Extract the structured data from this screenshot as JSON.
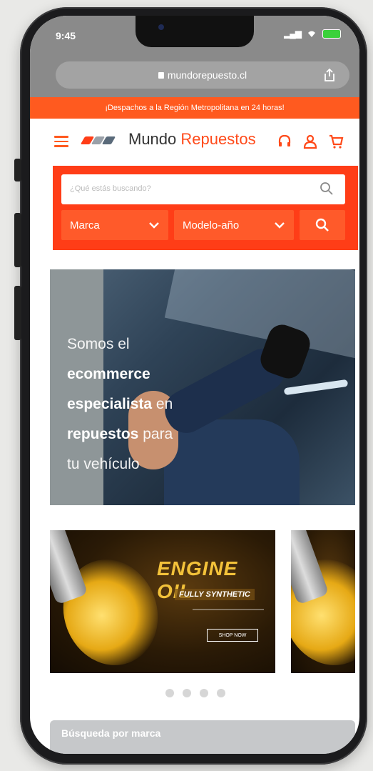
{
  "status_bar": {
    "time": "9:45"
  },
  "browser": {
    "url": "mundorepuesto.cl"
  },
  "promo_bar": {
    "text": "¡Despachos a la Región Metropolitana en 24 horas!"
  },
  "header": {
    "brand_part1": "Mundo",
    "brand_part2": "Repuestos",
    "logo_colors": [
      "#ff3d17",
      "#9aa0a8",
      "#5a6a7a"
    ],
    "icons": [
      "headset-icon",
      "user-icon",
      "cart-icon"
    ]
  },
  "search": {
    "placeholder": "¿Qué estás buscando?",
    "brand_select": "Marca",
    "model_select": "Modelo-año"
  },
  "hero": {
    "line1": "Somos el",
    "line2": "ecommerce",
    "line3_bold": "especialista",
    "line3_thin": " en",
    "line4_bold": "repuestos",
    "line4_thin": " para",
    "line5": "tu vehículo"
  },
  "carousel": {
    "banner_title": "ENGINE OIL",
    "banner_subtitle": "FULLY SYNTHETIC",
    "banner_button": "SHOP NOW",
    "dot_count": 4
  },
  "section": {
    "brand_search_title": "Búsqueda por marca"
  },
  "colors": {
    "accent": "#ff3d17",
    "promo": "#ff5a1f"
  }
}
